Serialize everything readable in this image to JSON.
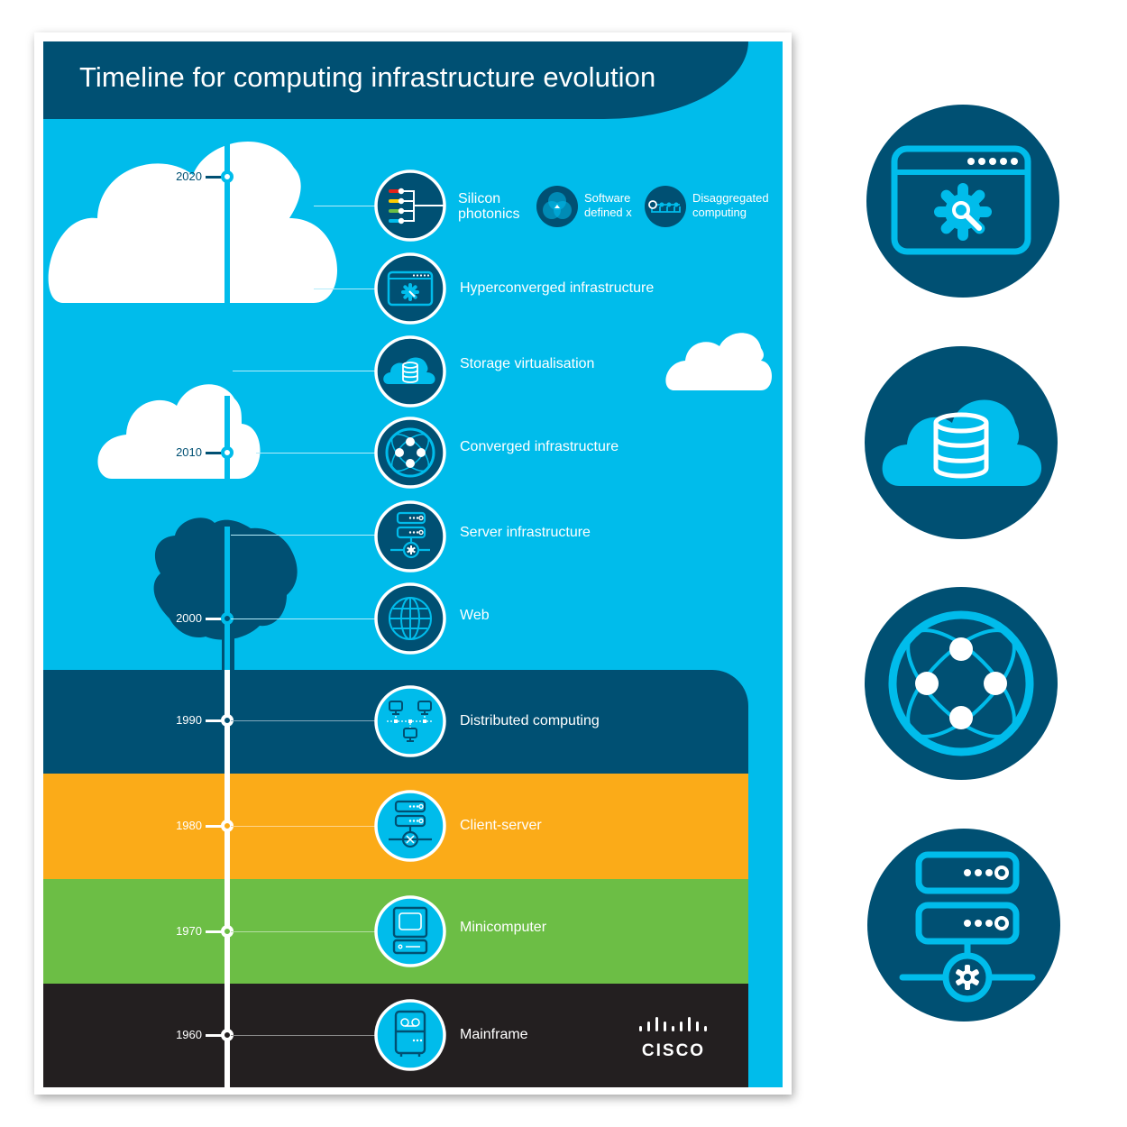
{
  "title": "Timeline for computing infrastructure evolution",
  "colors": {
    "sky": "#00bceb",
    "navy": "#005073",
    "orange": "#fbab18",
    "green": "#6cbe45",
    "black": "#231f20",
    "white": "#ffffff"
  },
  "years": [
    "2020",
    "2010",
    "2000",
    "1990",
    "1980",
    "1970",
    "1960"
  ],
  "milestones": [
    {
      "label": "Silicon photonics",
      "line1": "Silicon",
      "line2": "photonics",
      "icon": "silicon-photonics-icon"
    },
    {
      "label": "Hyperconverged infrastructure",
      "icon": "hyperconverged-icon"
    },
    {
      "label": "Storage virtualisation",
      "icon": "storage-cloud-icon"
    },
    {
      "label": "Converged infrastructure",
      "icon": "converged-network-icon"
    },
    {
      "label": "Server infrastructure",
      "icon": "server-infrastructure-icon"
    },
    {
      "label": "Web",
      "icon": "globe-icon"
    },
    {
      "label": "Distributed computing",
      "icon": "distributed-computers-icon"
    },
    {
      "label": "Client-server",
      "icon": "client-server-icon"
    },
    {
      "label": "Minicomputer",
      "icon": "minicomputer-icon"
    },
    {
      "label": "Mainframe",
      "icon": "mainframe-icon"
    }
  ],
  "extras": [
    {
      "line1": "Software",
      "line2": "defined x",
      "icon": "venn-icon"
    },
    {
      "line1": "Disaggregated",
      "line2": "computing",
      "icon": "disaggregated-icon"
    }
  ],
  "logo": {
    "text": "CISCO"
  },
  "side_icons": [
    "hyperconverged-icon",
    "storage-cloud-icon",
    "converged-network-icon",
    "server-infrastructure-icon"
  ]
}
